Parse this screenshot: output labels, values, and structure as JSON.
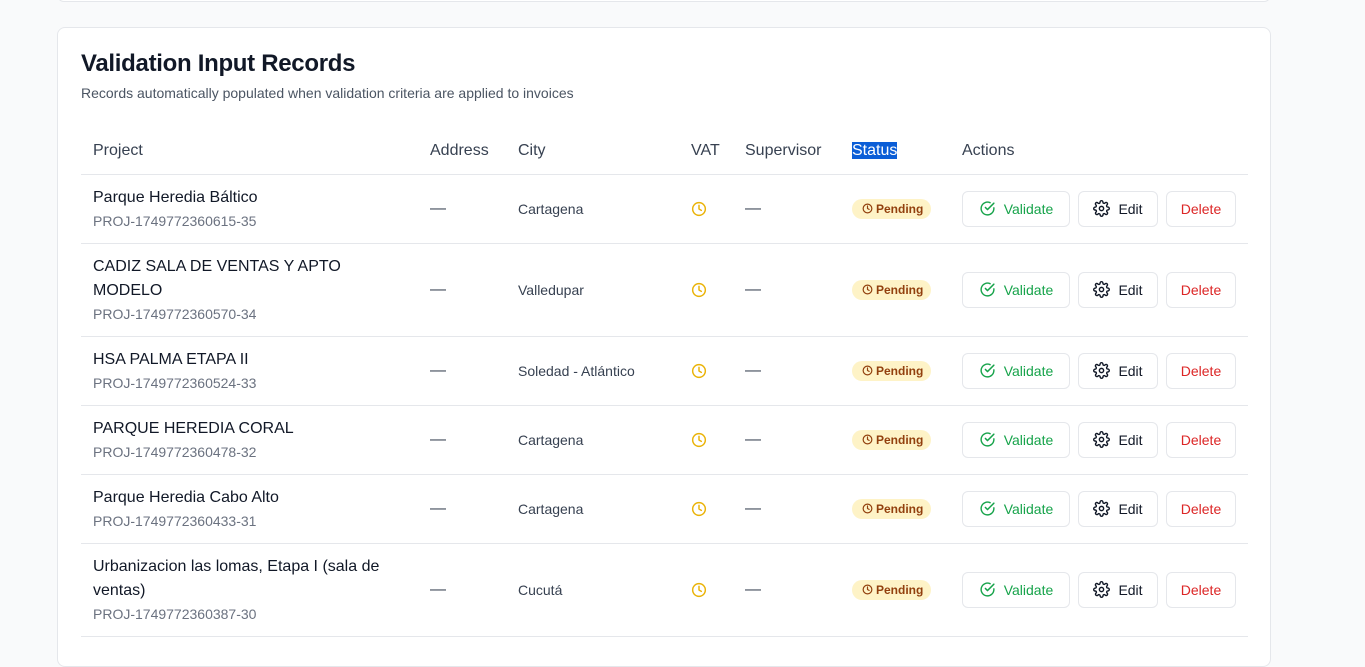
{
  "section": {
    "title": "Validation Input Records",
    "subtitle": "Records automatically populated when validation criteria are applied to invoices"
  },
  "columns": {
    "project": "Project",
    "address": "Address",
    "city": "City",
    "vat": "VAT",
    "supervisor": "Supervisor",
    "status": "Status",
    "actions": "Actions"
  },
  "buttons": {
    "validate": "Validate",
    "edit": "Edit",
    "delete": "Delete"
  },
  "status_label": "Pending",
  "colors": {
    "pending_bg": "#fef3c7",
    "pending_text": "#92400e",
    "clock": "#eab308",
    "validate": "#16a34a",
    "delete": "#dc2626",
    "selection": "#0b5ed7"
  },
  "rows": [
    {
      "name": "Parque Heredia Báltico",
      "id": "PROJ-1749772360615-35",
      "address": "—",
      "city": "Cartagena",
      "supervisor": "—"
    },
    {
      "name": "CADIZ SALA DE VENTAS Y APTO MODELO",
      "id": "PROJ-1749772360570-34",
      "address": "—",
      "city": "Valledupar",
      "supervisor": "—"
    },
    {
      "name": "HSA PALMA ETAPA II",
      "id": "PROJ-1749772360524-33",
      "address": "—",
      "city": "Soledad - Atlántico",
      "supervisor": "—"
    },
    {
      "name": "PARQUE HEREDIA CORAL",
      "id": "PROJ-1749772360478-32",
      "address": "—",
      "city": "Cartagena",
      "supervisor": "—"
    },
    {
      "name": "Parque Heredia Cabo Alto",
      "id": "PROJ-1749772360433-31",
      "address": "—",
      "city": "Cartagena",
      "supervisor": "—"
    },
    {
      "name": "Urbanizacion las lomas, Etapa I (sala de ventas)",
      "id": "PROJ-1749772360387-30",
      "address": "—",
      "city": "Cucutá",
      "supervisor": "—"
    }
  ]
}
